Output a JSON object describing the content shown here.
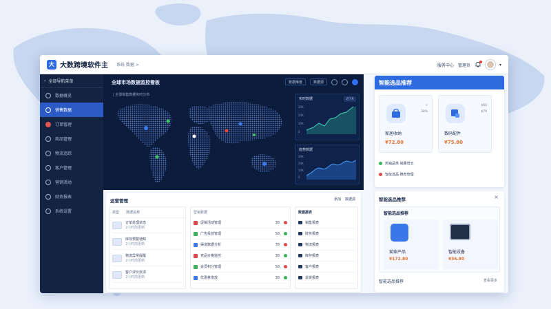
{
  "header": {
    "logo_letter": "大",
    "title": "大数跨境软件主",
    "breadcrumb": "系统 数据 >",
    "user_label": "管理员",
    "menu_label": "服务中心"
  },
  "sidebar": {
    "header": "全部导航菜单",
    "items": [
      {
        "label": "数据概览",
        "active": false
      },
      {
        "label": "销售数据",
        "active": true
      },
      {
        "label": "订单管理",
        "active": false
      },
      {
        "label": "商品管理",
        "active": false
      },
      {
        "label": "物流追踪",
        "active": false
      },
      {
        "label": "客户管理",
        "active": false
      },
      {
        "label": "营销活动",
        "active": false
      },
      {
        "label": "财务报表",
        "active": false
      },
      {
        "label": "系统设置",
        "active": false
      }
    ]
  },
  "map_panel": {
    "title": "全球市场数据监控看板",
    "subtitle": "| 全球销售数据实时分布",
    "buttons": [
      "数据维度",
      "数据源"
    ],
    "mini_charts": [
      {
        "title": "实时数据",
        "badge": "近7天",
        "ticks": [
          "30K",
          "20K",
          "10K",
          "0"
        ]
      },
      {
        "title": "趋势数据",
        "ticks": [
          "30K",
          "20K",
          "10K",
          "0"
        ]
      }
    ]
  },
  "recommend": {
    "title": "智能选品推荐",
    "products": [
      {
        "name": "家居收纳",
        "price": "¥72.80",
        "side": [
          "+",
          "38%"
        ]
      },
      {
        "name": "数码配件",
        "price": "¥75.80",
        "side": [
          "$60",
          "$79"
        ]
      }
    ],
    "rows": [
      "热销品类 销量增长",
      "智能选品 推荐管理"
    ]
  },
  "bottom_left": {
    "title": "运营管理",
    "toolbar": [
      "添加",
      "数据源"
    ],
    "columns": [
      "类型",
      "数据名称"
    ],
    "rows": [
      {
        "name": "订单处理状态",
        "info": "2小时前更新"
      },
      {
        "name": "库存预警通知",
        "info": "2小时前更新"
      },
      {
        "name": "物流异常提醒",
        "info": "2小时前更新"
      },
      {
        "name": "客户评价反馈",
        "info": "2小时前更新"
      }
    ],
    "list_title": "营销数据",
    "list_rows": [
      "促销活动管理",
      "广告投放管理",
      "渠道数据分析",
      "竞品价格监控",
      "会员积分管理",
      "优惠券发放"
    ],
    "list_vals": [
      "38",
      "58",
      "78",
      "38",
      "58",
      "38"
    ],
    "side_title": "数据报表",
    "side_rows": [
      "销售报表",
      "财务报表",
      "物流报表",
      "库存报表",
      "客户报表",
      "退货报表"
    ]
  },
  "recommend2": {
    "title": "智能选品推荐",
    "card_title": "智能选品推荐",
    "products": [
      {
        "name": "爱家产品",
        "price": "¥172.80"
      },
      {
        "name": "智能设备",
        "price": "¥36.80"
      }
    ],
    "footer_left": "智能选品推荐",
    "footer_right": "查看更多"
  }
}
